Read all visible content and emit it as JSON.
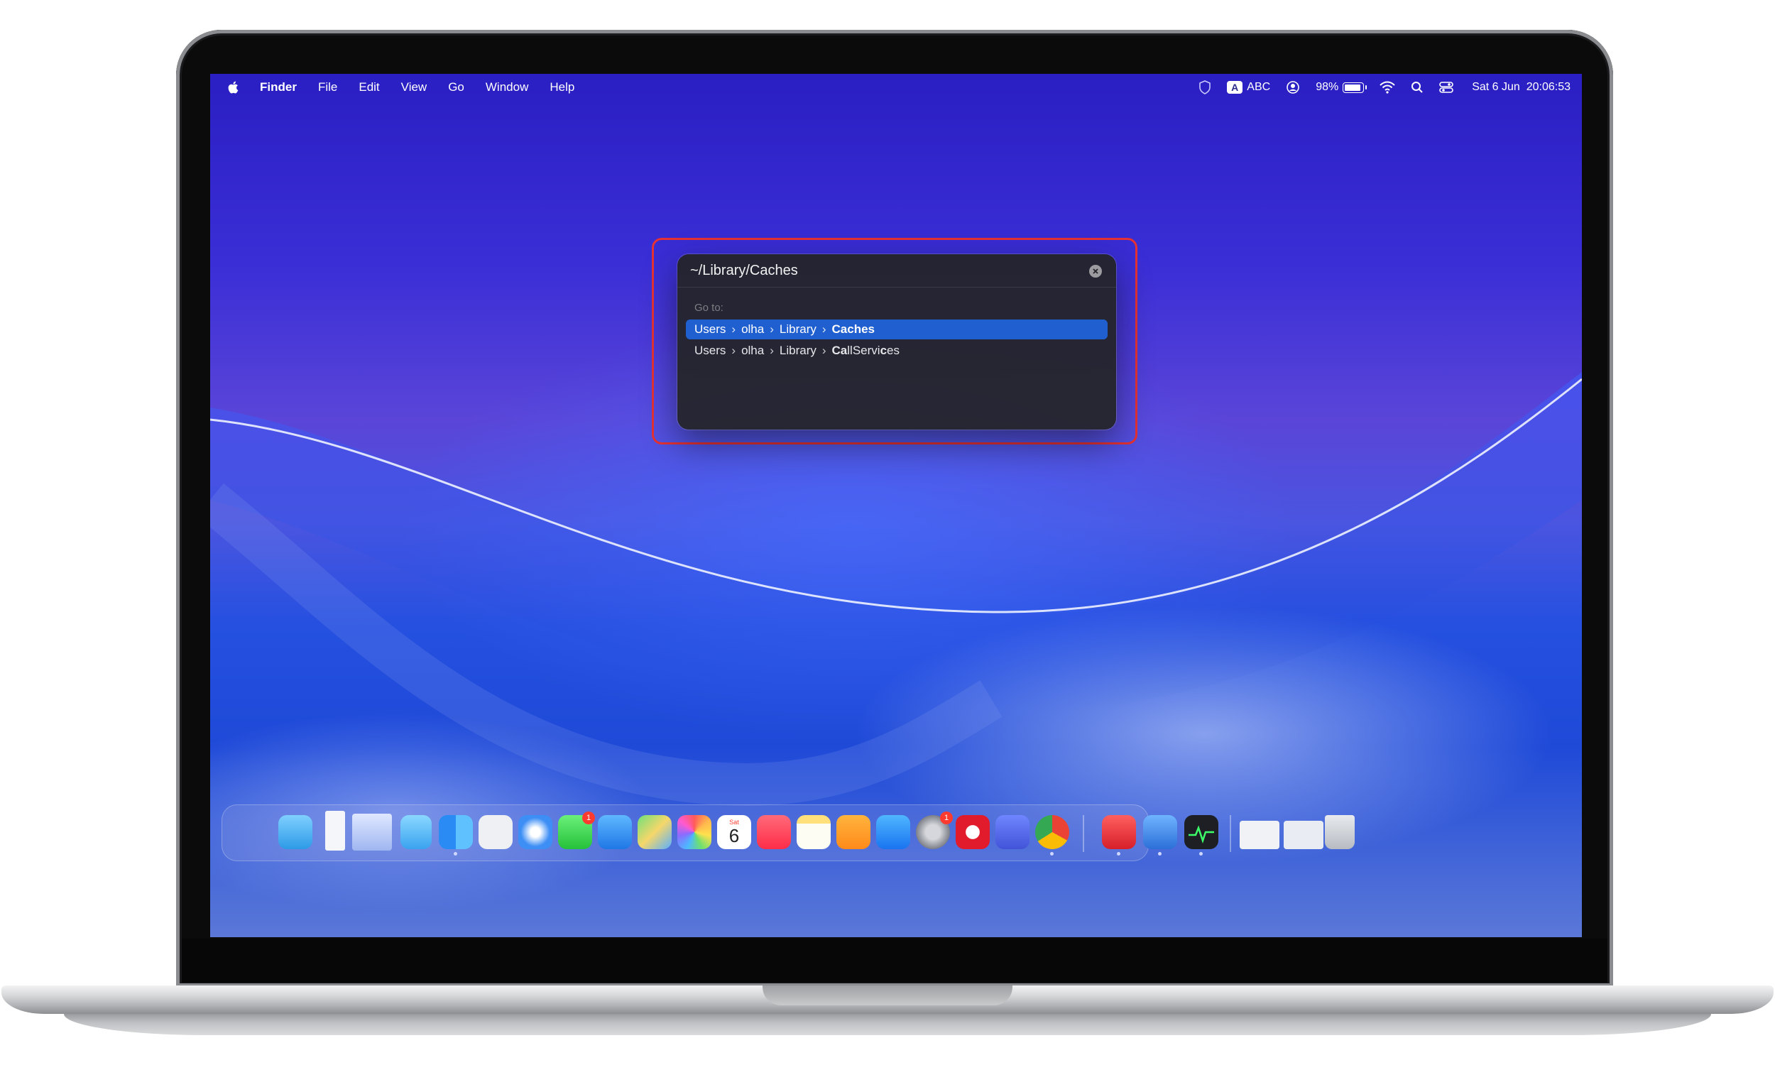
{
  "menubar": {
    "app_name": "Finder",
    "menus": [
      "File",
      "Edit",
      "View",
      "Go",
      "Window",
      "Help"
    ],
    "input_source": "ABC",
    "input_badge": "A",
    "battery_percent": "98%",
    "battery_level": 0.98,
    "datetime": "Sat 6 Jun  20:06:53"
  },
  "goto": {
    "path_value": "~/Library/Caches",
    "section_label": "Go to:",
    "results": [
      {
        "segments": [
          "Users",
          "olha",
          "Library"
        ],
        "last": "Caches",
        "selected": true
      },
      {
        "segments": [
          "Users",
          "olha",
          "Library"
        ],
        "last": "CallServices",
        "selected": false
      }
    ]
  },
  "dock": {
    "calendar_day": "6",
    "calendar_month": "Sat",
    "messages_badge": "1",
    "settings_badge": "1",
    "apps": [
      "folder",
      "document-stack",
      "image-stack",
      "folder",
      "finder",
      "launchpad",
      "safari",
      "messages",
      "mail",
      "maps",
      "photos",
      "calendar",
      "music",
      "notes",
      "pages",
      "app-store",
      "system-settings",
      "opera",
      "simulator",
      "chrome",
      "antivirus",
      "backup",
      "activity-monitor",
      "window-preview",
      "window-preview",
      "trash"
    ]
  },
  "colors": {
    "highlight": "#e53234",
    "selection": "#1f5fd0"
  }
}
